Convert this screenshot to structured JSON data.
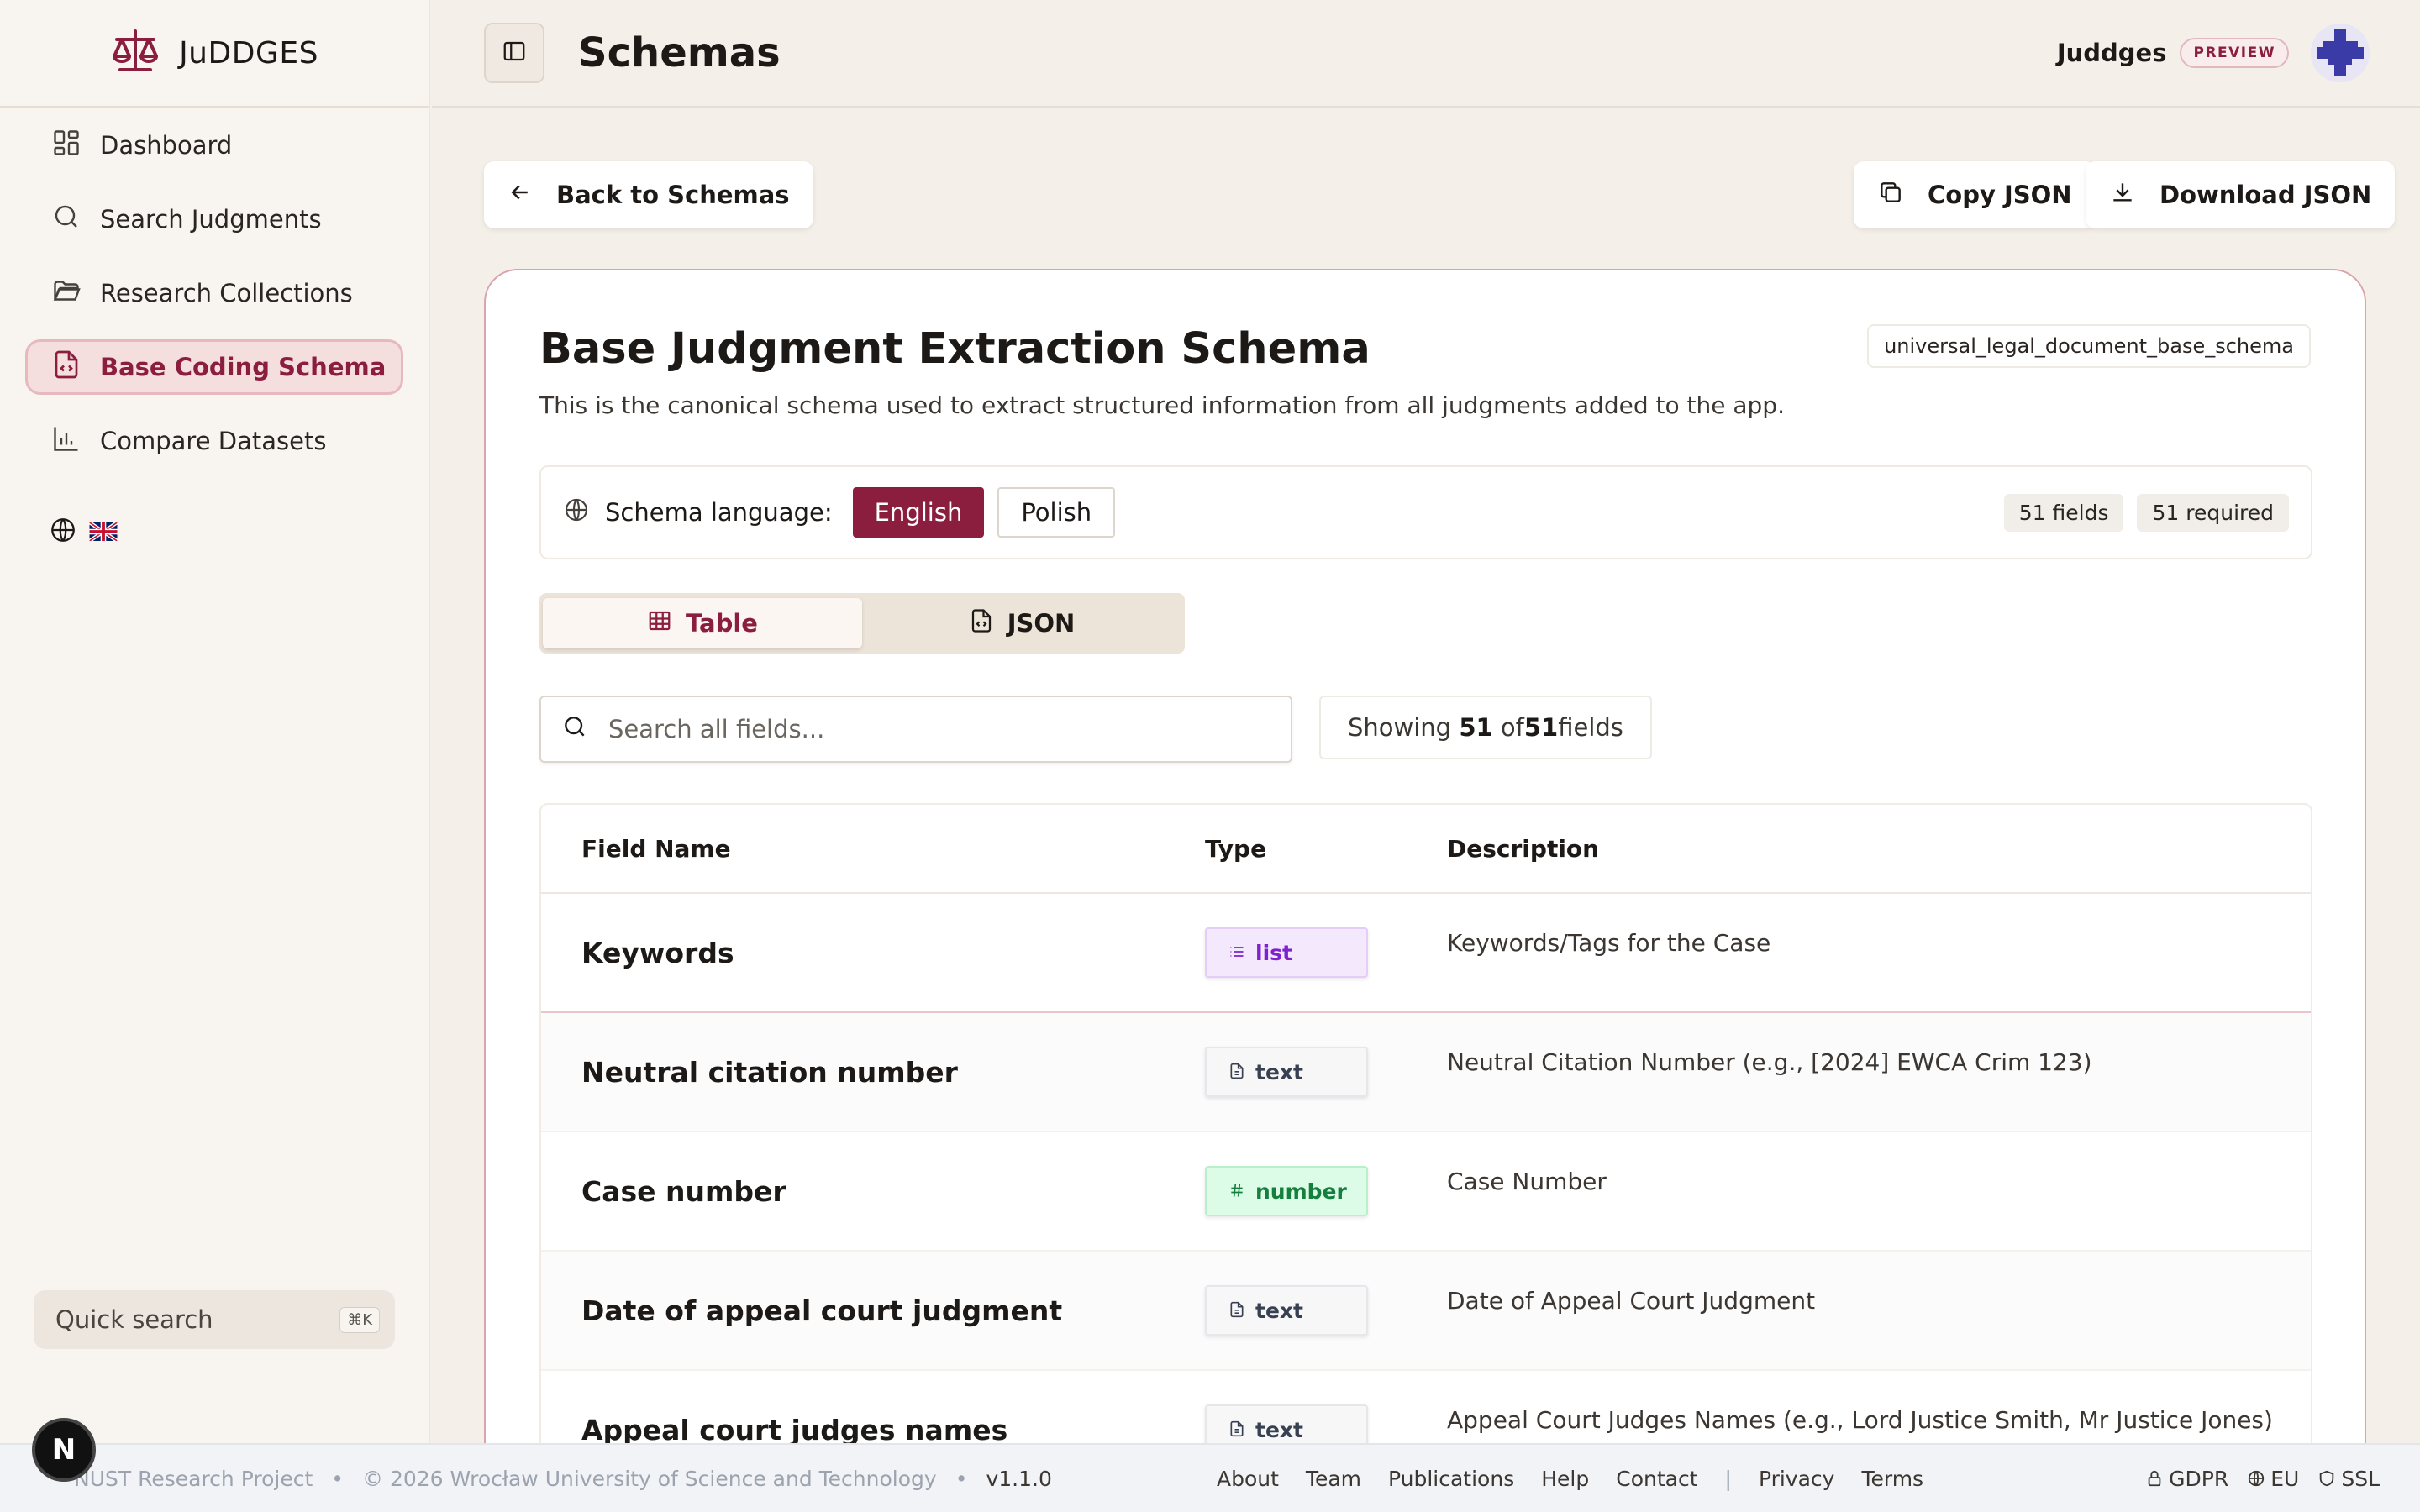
{
  "brand": {
    "name": "JuDDGES"
  },
  "sidebar": {
    "items": [
      {
        "label": "Dashboard",
        "icon": "dashboard-icon"
      },
      {
        "label": "Search Judgments",
        "icon": "search-icon"
      },
      {
        "label": "Research Collections",
        "icon": "folder-icon"
      },
      {
        "label": "Base Coding Schema",
        "icon": "file-code-icon",
        "active": true
      },
      {
        "label": "Compare Datasets",
        "icon": "bar-chart-icon"
      }
    ],
    "quick_search": {
      "label": "Quick search",
      "shortcut": "⌘K"
    },
    "n_badge": "N"
  },
  "header": {
    "title": "Schemas",
    "app_name": "Juddges",
    "badge": "PREVIEW"
  },
  "toolbar": {
    "back_label": "Back to Schemas",
    "copy_label": "Copy JSON",
    "download_label": "Download JSON"
  },
  "schema": {
    "title": "Base Judgment Extraction Schema",
    "description": "This is the canonical schema used to extract structured information from all judgments added to the app.",
    "id": "universal_legal_document_base_schema",
    "language_label": "Schema language:",
    "languages": [
      "English",
      "Polish"
    ],
    "selected_language": "English",
    "fields_count": "51 fields",
    "required_count": "51 required"
  },
  "view": {
    "tabs": [
      "Table",
      "JSON"
    ],
    "active": "Table"
  },
  "search": {
    "placeholder": "Search all fields...",
    "showing_prefix": "Showing ",
    "showing_count": "51",
    "showing_of": " of",
    "showing_total": "51",
    "showing_suffix": " fields"
  },
  "table": {
    "headers": [
      "Field Name",
      "Type",
      "Description"
    ],
    "rows": [
      {
        "name": "Keywords",
        "type": "list",
        "description": "Keywords/Tags for the Case"
      },
      {
        "name": "Neutral citation number",
        "type": "text",
        "description": "Neutral Citation Number (e.g., [2024] EWCA Crim 123)"
      },
      {
        "name": "Case number",
        "type": "number",
        "description": "Case Number"
      },
      {
        "name": "Date of appeal court judgment",
        "type": "text",
        "description": "Date of Appeal Court Judgment"
      },
      {
        "name": "Appeal court judges names",
        "type": "text",
        "description": "Appeal Court Judges Names (e.g., Lord Justice Smith, Mr Justice Jones)"
      }
    ]
  },
  "footer": {
    "project": "NUST Research Project",
    "copyright": "© 2026 Wrocław University of Science and Technology",
    "version": "v1.1.0",
    "links": [
      "About",
      "Team",
      "Publications",
      "Help",
      "Contact"
    ],
    "legal": [
      "Privacy",
      "Terms"
    ],
    "badges": [
      "GDPR",
      "EU",
      "SSL"
    ]
  },
  "colors": {
    "accent": "#8b1e3f",
    "background": "#f4efe8",
    "sidebar": "#f8f5f1"
  }
}
